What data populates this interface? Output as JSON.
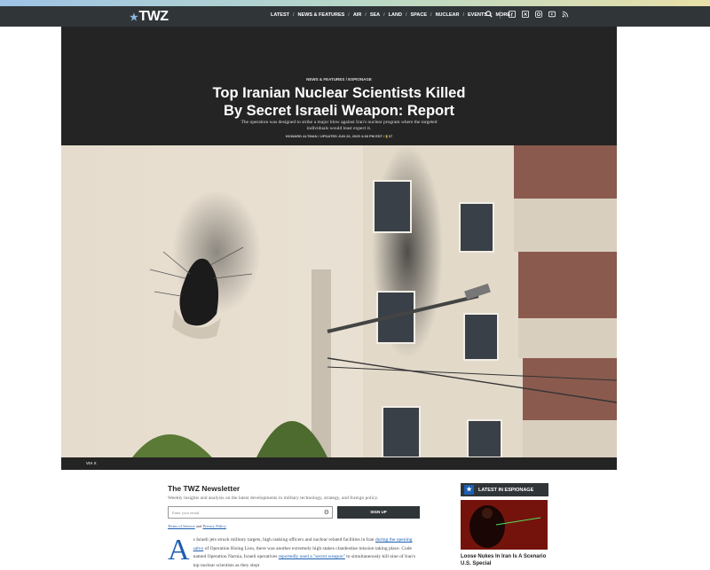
{
  "nav": {
    "logo": "TWZ",
    "links": [
      "LATEST",
      "NEWS & FEATURES",
      "AIR",
      "SEA",
      "LAND",
      "SPACE",
      "NUCLEAR",
      "EVENTS",
      "MORE"
    ],
    "icons": [
      "search-icon",
      "facebook-icon",
      "x-icon",
      "instagram-icon",
      "youtube-icon",
      "rss-icon"
    ]
  },
  "article": {
    "category": "NEWS & FEATURES",
    "subcategory": "ESPIONAGE",
    "title": "Top Iranian Nuclear Scientists Killed By Secret Israeli Weapon: Report",
    "subtitle": "The operation was designed to strike a major blow against Iran's nuclear program where the targeted individuals would least expect it.",
    "author": "HOWARD ALTMAN",
    "updated": "UPDATED JUN 26, 2025 4:38 PM EDT",
    "comments": "37",
    "photo_credit": "VIA X",
    "dropcap": "A",
    "body_1": "s Israeli jets struck military targets, high ranking officers and nuclear related facilities in Iran",
    "body_link_1": "during the opening salvo",
    "body_2": " of Operation Rising Lion, there was another extremely high stakes clandestine mission taking place. Code named Operation Narnia, Israeli operatives ",
    "body_link_2": "reportedly used a \"secret weapon\"",
    "body_3": " to simultaneously kill nine of Iran's top nuclear scientists as they slept"
  },
  "newsletter": {
    "title": "The TWZ Newsletter",
    "description": "Weekly insights and analysis on the latest developments in military technology, strategy, and foreign policy.",
    "email_placeholder": "Enter your email",
    "signup_label": "SIGN UP",
    "terms_label": "Terms of Service",
    "and_label": " and ",
    "privacy_label": "Privacy Policy"
  },
  "sidebar": {
    "heading": "LATEST IN ESPIONAGE",
    "story_title": "Loose Nukes In Iran Is A Scenario U.S. Special"
  }
}
